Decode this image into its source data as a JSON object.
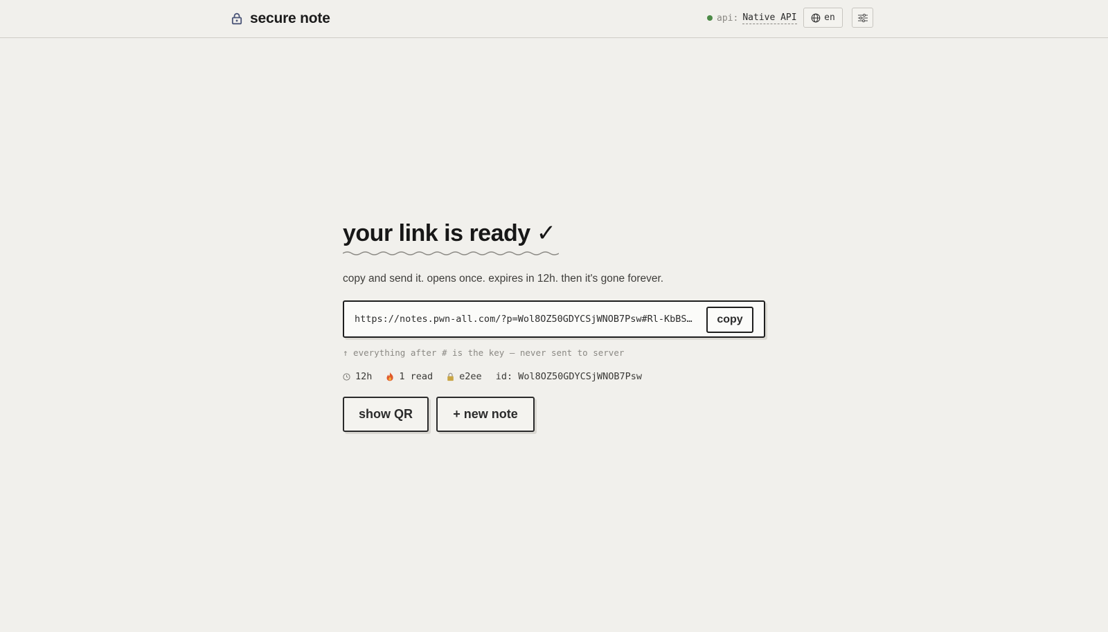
{
  "header": {
    "title": "secure note",
    "api": {
      "label": "api:",
      "value": "Native API",
      "status_color": "#4c8a47"
    },
    "language": "en",
    "icons": [
      "lock-icon",
      "globe-icon",
      "sliders-icon"
    ]
  },
  "main": {
    "heading": "your link is ready",
    "heading_mark": "✓",
    "subtitle": "copy and send it. opens once. expires in 12h. then it's gone forever.",
    "link": {
      "url": "https://notes.pwn-all.com/?p=Wol8OZ50GDYCSjWNOB7Psw#Rl-KbBScR…",
      "copy_label": "copy"
    },
    "hint": "↑ everything after # is the key — never sent to server",
    "meta": {
      "expiry": "12h",
      "reads": "1 read",
      "encryption": "e2ee",
      "id": "id: Wol8OZ50GDYCSjWNOB7Psw"
    },
    "actions": {
      "qr_label": "show QR",
      "new_label": "+ new note"
    }
  },
  "colors": {
    "background": "#f1f0ec",
    "text": "#1c1c1c",
    "muted": "#8a8883",
    "accent_lock": "#4a5477",
    "status_ok": "#4c8a47"
  }
}
